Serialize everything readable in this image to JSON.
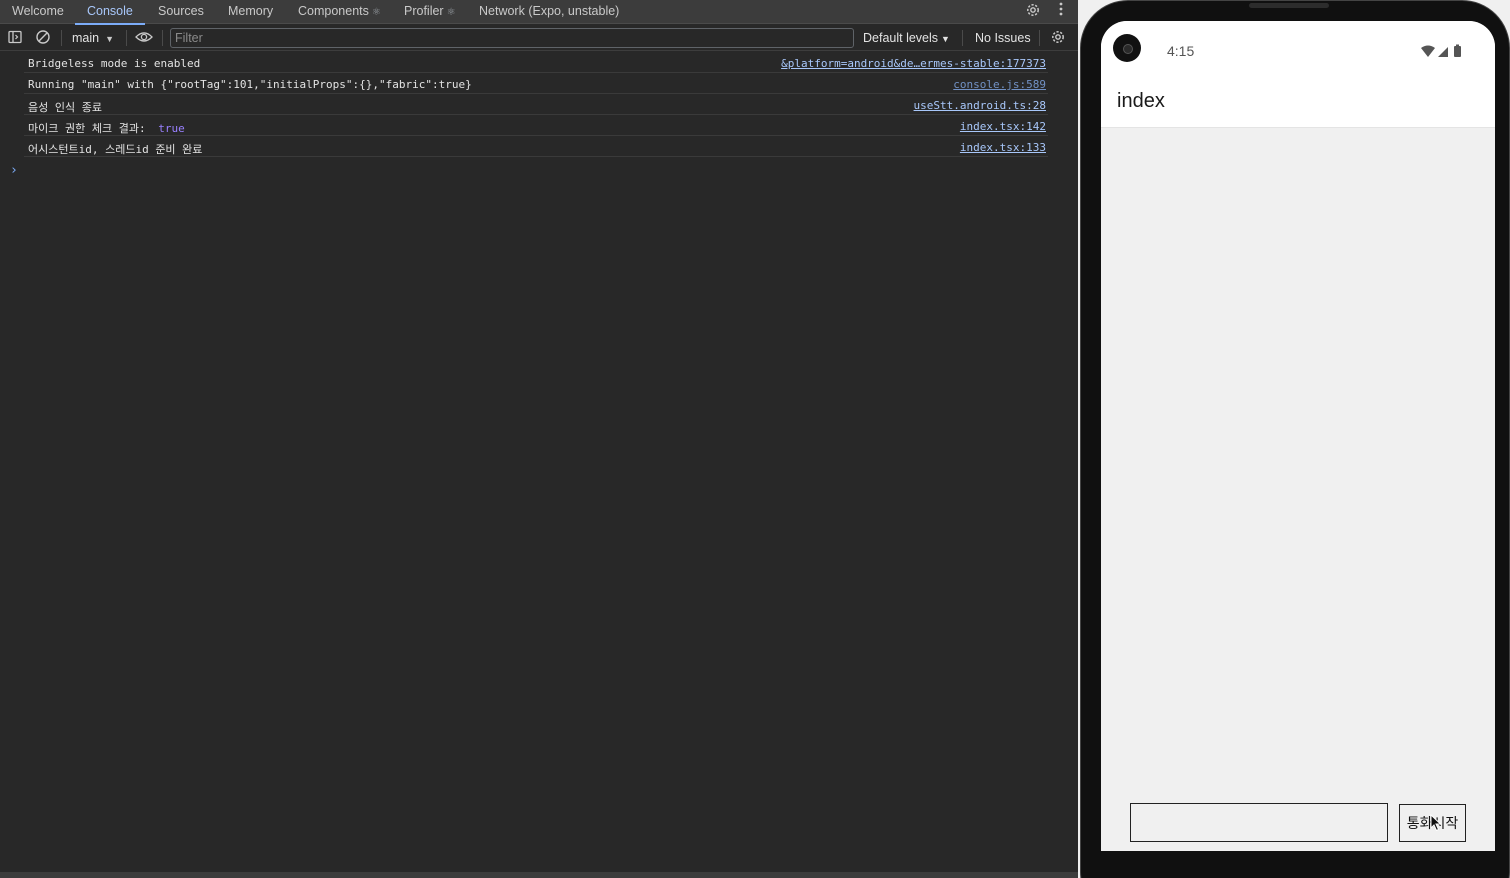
{
  "devtools": {
    "tabs": [
      {
        "label": "Welcome",
        "experimental": false
      },
      {
        "label": "Console",
        "experimental": false
      },
      {
        "label": "Sources",
        "experimental": false
      },
      {
        "label": "Memory",
        "experimental": false
      },
      {
        "label": "Components",
        "experimental": true
      },
      {
        "label": "Profiler",
        "experimental": true
      },
      {
        "label": "Network (Expo, unstable)",
        "experimental": false
      }
    ],
    "active_tab": "Console",
    "experimental_marker": "⚛",
    "toolbar": {
      "context": "main",
      "filter_placeholder": "Filter",
      "levels_label": "Default levels",
      "issues_label": "No Issues"
    },
    "logs": [
      {
        "message": "Bridgeless mode is enabled",
        "value": "",
        "source": "&platform=android&de…ermes-stable:177373"
      },
      {
        "message": "Running \"main\" with {\"rootTag\":101,\"initialProps\":{},\"fabric\":true}",
        "value": "",
        "source": "console.js:589"
      },
      {
        "message": "음성 인식 종료",
        "value": "",
        "source": "useStt.android.ts:28"
      },
      {
        "message": "마이크 권한 체크 결과: ",
        "value": "true",
        "source": "index.tsx:142"
      },
      {
        "message": "어시스턴트id, 스레드id 준비 완료",
        "value": "",
        "source": "index.tsx:133"
      }
    ],
    "prompt_symbol": "›"
  },
  "device": {
    "time": "4:15",
    "app_title": "index",
    "text_input_value": "",
    "call_button_label": "통화시작"
  },
  "colors": {
    "devtools_bg": "#282828",
    "tabbar_bg": "#3c3c3c",
    "active_tab": "#a8c7fa",
    "link": "#a8c7fa",
    "boolean_value": "#9980ff",
    "device_bg": "#f0f0f0"
  }
}
